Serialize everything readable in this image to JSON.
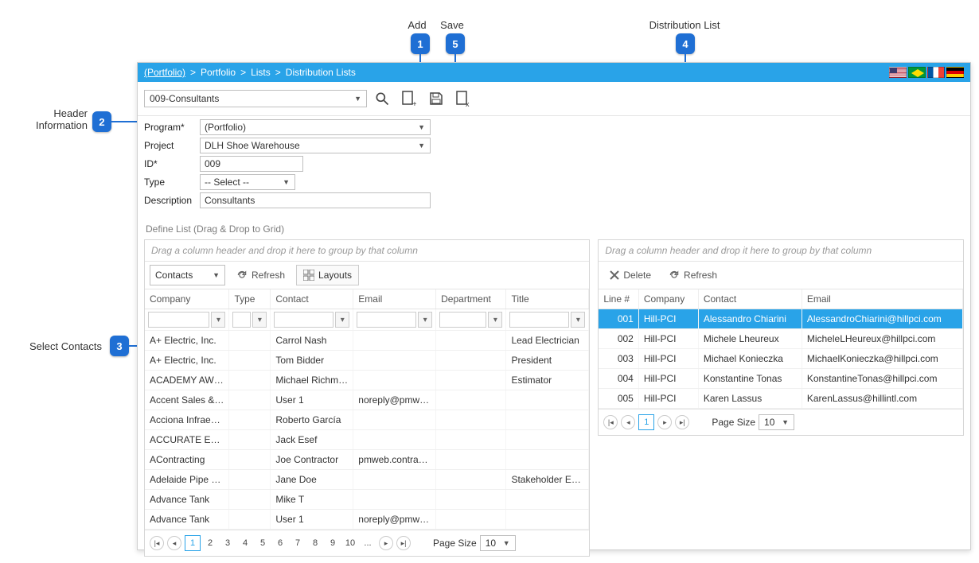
{
  "callouts": {
    "add": "Add",
    "save": "Save",
    "distribution_list": "Distribution List",
    "header_info_line1": "Header",
    "header_info_line2": "Information",
    "select_contacts": "Select Contacts"
  },
  "breadcrumb": {
    "root": "(Portfolio)",
    "p1": "Portfolio",
    "p2": "Lists",
    "p3": "Distribution Lists"
  },
  "record_selector": "009-Consultants",
  "form": {
    "program_label": "Program*",
    "program_value": "(Portfolio)",
    "project_label": "Project",
    "project_value": "DLH Shoe Warehouse",
    "id_label": "ID*",
    "id_value": "009",
    "type_label": "Type",
    "type_value": "-- Select --",
    "description_label": "Description",
    "description_value": "Consultants"
  },
  "section_title": "Define List (Drag & Drop to Grid)",
  "left_panel": {
    "group_hint": "Drag a column header and drop it here to group by that column",
    "source_dropdown": "Contacts",
    "refresh": "Refresh",
    "layouts": "Layouts",
    "columns": {
      "company": "Company",
      "type": "Type",
      "contact": "Contact",
      "email": "Email",
      "department": "Department",
      "title": "Title"
    },
    "rows": [
      {
        "company": "A+ Electric, Inc.",
        "type": "",
        "contact": "Carrol Nash",
        "email": "",
        "department": "",
        "title": "Lead Electrician"
      },
      {
        "company": "A+ Electric, Inc.",
        "type": "",
        "contact": "Tom Bidder",
        "email": "",
        "department": "",
        "title": "President"
      },
      {
        "company": "ACADEMY AWNING",
        "type": "",
        "contact": "Michael Richman",
        "email": "",
        "department": "",
        "title": "Estimator"
      },
      {
        "company": "Accent Sales & Se",
        "type": "",
        "contact": "User 1",
        "email": "noreply@pmweb.",
        "department": "",
        "title": ""
      },
      {
        "company": "Acciona Infraestru",
        "type": "",
        "contact": "Roberto García",
        "email": "",
        "department": "",
        "title": ""
      },
      {
        "company": "ACCURATE ELECT",
        "type": "",
        "contact": "Jack Esef",
        "email": "",
        "department": "",
        "title": ""
      },
      {
        "company": "AContracting",
        "type": "",
        "contact": "Joe Contractor",
        "email": "pmweb.contracto",
        "department": "",
        "title": ""
      },
      {
        "company": "Adelaide Pipe Rela",
        "type": "",
        "contact": "Jane Doe",
        "email": "",
        "department": "",
        "title": "Stakeholder Engag"
      },
      {
        "company": "Advance Tank",
        "type": "",
        "contact": "Mike T",
        "email": "",
        "department": "",
        "title": ""
      },
      {
        "company": "Advance Tank",
        "type": "",
        "contact": "User 1",
        "email": "noreply@pmweb.",
        "department": "",
        "title": ""
      }
    ],
    "pager": {
      "pages": [
        "1",
        "2",
        "3",
        "4",
        "5",
        "6",
        "7",
        "8",
        "9",
        "10",
        "..."
      ],
      "page_size_label": "Page Size",
      "page_size": "10"
    }
  },
  "right_panel": {
    "group_hint": "Drag a column header and drop it here to group by that column",
    "delete": "Delete",
    "refresh": "Refresh",
    "columns": {
      "line": "Line #",
      "company": "Company",
      "contact": "Contact",
      "email": "Email"
    },
    "rows": [
      {
        "line": "001",
        "company": "Hill-PCI",
        "contact": "Alessandro Chiarini",
        "email": "AlessandroChiarini@hillpci.com"
      },
      {
        "line": "002",
        "company": "Hill-PCI",
        "contact": "Michele Lheureux",
        "email": "MicheleLHeureux@hillpci.com"
      },
      {
        "line": "003",
        "company": "Hill-PCI",
        "contact": "Michael Konieczka",
        "email": "MichaelKonieczka@hillpci.com"
      },
      {
        "line": "004",
        "company": "Hill-PCI",
        "contact": "Konstantine Tonas",
        "email": "KonstantineTonas@hillpci.com"
      },
      {
        "line": "005",
        "company": "Hill-PCI",
        "contact": "Karen Lassus",
        "email": "KarenLassus@hillintl.com"
      }
    ],
    "pager": {
      "pages": [
        "1"
      ],
      "page_size_label": "Page Size",
      "page_size": "10"
    }
  }
}
